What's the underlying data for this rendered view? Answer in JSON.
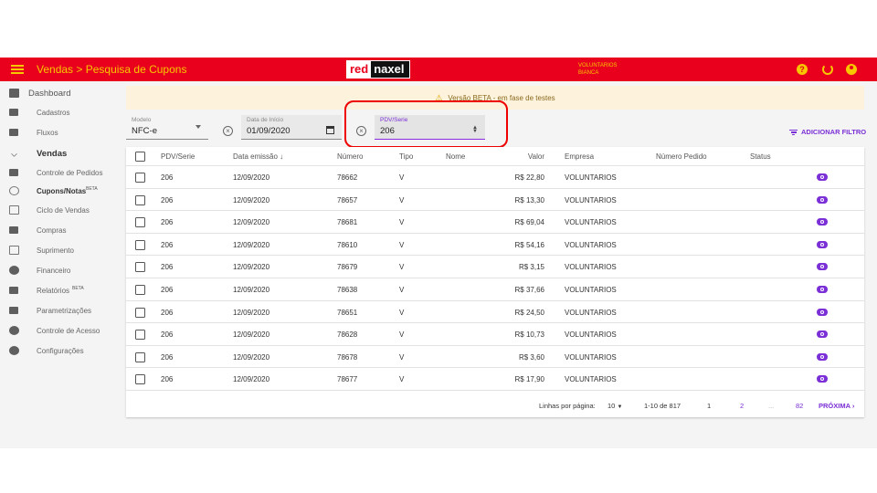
{
  "header": {
    "title": "Vendas > Pesquisa de Cupons",
    "logo_red": "red",
    "logo_black": "naxel",
    "company": "VOLUNTARIOS",
    "user": "BIANCA",
    "colors": {
      "bar": "#e8001c",
      "accent": "#f7c800",
      "link": "#7b2fd6"
    }
  },
  "sidebar": {
    "items": [
      {
        "label": "Dashboard",
        "icon": "dashboard-icon"
      },
      {
        "label": "Cadastros",
        "icon": "folder-icon"
      },
      {
        "label": "Fluxos",
        "icon": "columns-icon"
      },
      {
        "label": "Vendas",
        "icon": "chevron-down-icon"
      },
      {
        "label": "Controle de Pedidos",
        "icon": "list-icon"
      },
      {
        "label": "Cupons/Notas",
        "badge": "BETA",
        "icon": "search-receipt-icon"
      },
      {
        "label": "Ciclo de Vendas",
        "icon": "infinity-icon"
      },
      {
        "label": "Compras",
        "icon": "building-icon"
      },
      {
        "label": "Suprimento",
        "icon": "box-icon"
      },
      {
        "label": "Financeiro",
        "icon": "money-icon"
      },
      {
        "label": "Relatórios",
        "badge": "BETA",
        "icon": "print-icon"
      },
      {
        "label": "Parametrizações",
        "icon": "sliders-icon"
      },
      {
        "label": "Controle de Acesso",
        "icon": "shield-icon"
      },
      {
        "label": "Configurações",
        "icon": "gear-icon"
      }
    ]
  },
  "banner": {
    "text": "Versão BETA - em fase de testes",
    "icon": "warning-icon"
  },
  "filters": {
    "modelo": {
      "label": "Modelo",
      "value": "NFC-e"
    },
    "data_inicio": {
      "label": "Data de Início",
      "value": "01/09/2020"
    },
    "pdv_serie": {
      "label": "PDV/Serie",
      "value": "206"
    },
    "add_filter": "ADICIONAR FILTRO"
  },
  "table": {
    "columns": [
      "PDV/Serie",
      "Data emissão",
      "Número",
      "Tipo",
      "Nome",
      "Valor",
      "Empresa",
      "Número Pedido",
      "Status"
    ],
    "sort_arrow": "↓",
    "rows": [
      {
        "pdv": "206",
        "data": "12/09/2020",
        "numero": "78662",
        "tipo": "V",
        "nome": "",
        "valor": "R$ 22,80",
        "empresa": "VOLUNTARIOS",
        "pedido": "",
        "status": ""
      },
      {
        "pdv": "206",
        "data": "12/09/2020",
        "numero": "78657",
        "tipo": "V",
        "nome": "",
        "valor": "R$ 13,30",
        "empresa": "VOLUNTARIOS",
        "pedido": "",
        "status": ""
      },
      {
        "pdv": "206",
        "data": "12/09/2020",
        "numero": "78681",
        "tipo": "V",
        "nome": "",
        "valor": "R$ 69,04",
        "empresa": "VOLUNTARIOS",
        "pedido": "",
        "status": ""
      },
      {
        "pdv": "206",
        "data": "12/09/2020",
        "numero": "78610",
        "tipo": "V",
        "nome": "",
        "valor": "R$ 54,16",
        "empresa": "VOLUNTARIOS",
        "pedido": "",
        "status": ""
      },
      {
        "pdv": "206",
        "data": "12/09/2020",
        "numero": "78679",
        "tipo": "V",
        "nome": "",
        "valor": "R$ 3,15",
        "empresa": "VOLUNTARIOS",
        "pedido": "",
        "status": ""
      },
      {
        "pdv": "206",
        "data": "12/09/2020",
        "numero": "78638",
        "tipo": "V",
        "nome": "",
        "valor": "R$ 37,66",
        "empresa": "VOLUNTARIOS",
        "pedido": "",
        "status": ""
      },
      {
        "pdv": "206",
        "data": "12/09/2020",
        "numero": "78651",
        "tipo": "V",
        "nome": "",
        "valor": "R$ 24,50",
        "empresa": "VOLUNTARIOS",
        "pedido": "",
        "status": ""
      },
      {
        "pdv": "206",
        "data": "12/09/2020",
        "numero": "78628",
        "tipo": "V",
        "nome": "",
        "valor": "R$ 10,73",
        "empresa": "VOLUNTARIOS",
        "pedido": "",
        "status": ""
      },
      {
        "pdv": "206",
        "data": "12/09/2020",
        "numero": "78678",
        "tipo": "V",
        "nome": "",
        "valor": "R$ 3,60",
        "empresa": "VOLUNTARIOS",
        "pedido": "",
        "status": ""
      },
      {
        "pdv": "206",
        "data": "12/09/2020",
        "numero": "78677",
        "tipo": "V",
        "nome": "",
        "valor": "R$ 17,90",
        "empresa": "VOLUNTARIOS",
        "pedido": "",
        "status": ""
      }
    ]
  },
  "pagination": {
    "rows_label": "Linhas por página:",
    "rows_value": "10",
    "range": "1-10 de 817",
    "pages": [
      "1",
      "2",
      "...",
      "82"
    ],
    "next": "PRÓXIMA"
  }
}
